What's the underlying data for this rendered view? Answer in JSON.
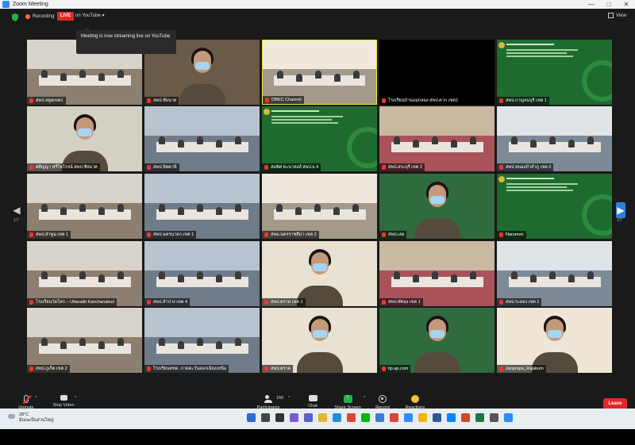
{
  "window": {
    "title": "Zoom Meeting",
    "controls": [
      "—",
      "□",
      "✕"
    ]
  },
  "topbar": {
    "recording_label": "Recording",
    "live_badge": "LIVE",
    "stream_label": "on YouTube",
    "view_label": "View"
  },
  "tooltip": {
    "text": "Meeting is now streaming live on YouTube"
  },
  "pager": {
    "left_page": "1/7",
    "right_page": "1/7"
  },
  "tiles": [
    {
      "name": "สพป.สตูลเขต1",
      "kind": "room"
    },
    {
      "name": "สพป.ชัยนาท",
      "kind": "person"
    },
    {
      "name": "OBEC Channel",
      "kind": "room",
      "active": true
    },
    {
      "name": "โรงเรียนบ้านแม่กลอง สพป.ตาก เขต2",
      "kind": "empty"
    },
    {
      "name": "สพป.กาญจนบุรี เขต 1",
      "kind": "green"
    },
    {
      "name": "ศศิญญา ศรีไพโรจน์ สพป.ชัยนาท",
      "kind": "person"
    },
    {
      "name": "สพป.ปัตตานี",
      "kind": "room"
    },
    {
      "name": "สมพิศ ทะนาหงส์ สพป.อ.4",
      "kind": "green"
    },
    {
      "name": "สพป.สระบุรี เขต 2",
      "kind": "room"
    },
    {
      "name": "สพป.หนองบัวลำภู เขต 2",
      "kind": "room"
    },
    {
      "name": "สพป.ลำพูน เขต 1",
      "kind": "room"
    },
    {
      "name": "สพป.นครนายก เขต 1",
      "kind": "room"
    },
    {
      "name": "สพม.นครราชสีมา เขต 2",
      "kind": "room"
    },
    {
      "name": "สพป.เลย",
      "kind": "person"
    },
    {
      "name": "Narumon",
      "kind": "green"
    },
    {
      "name": "โรงเรียนวัดโคก – Uttaradit Kanchanaburi",
      "kind": "room"
    },
    {
      "name": "สพป.ลำปาง เขต 4",
      "kind": "room"
    },
    {
      "name": "สพป.ตราด เขต 1",
      "kind": "person"
    },
    {
      "name": "สพป.พัทลุง เขต 1",
      "kind": "room"
    },
    {
      "name": "สพป.ระยอง เขต 1",
      "kind": "room"
    },
    {
      "name": "สพป.ภูเก็ต เขต 2",
      "kind": "room"
    },
    {
      "name": "โรงเรียนตชด. ภาคตะวันออกเฉียงเหนือ",
      "kind": "room"
    },
    {
      "name": "สพป.ตราด",
      "kind": "person"
    },
    {
      "name": "tip.ap.com",
      "kind": "person"
    },
    {
      "name": "Janprapa_Rajakum",
      "kind": "person"
    }
  ],
  "toolbar": {
    "unmute": "Unmute",
    "stop_video": "Stop Video",
    "participants": "Participants",
    "participants_count": "160",
    "chat": "Chat",
    "share_screen": "Share Screen",
    "record": "Record",
    "reactions": "Reactions",
    "leave": "Leave"
  },
  "taskbar": {
    "weather_temp": "28°C",
    "weather_desc": "มีเมฆเป็นส่วนใหญ่"
  }
}
